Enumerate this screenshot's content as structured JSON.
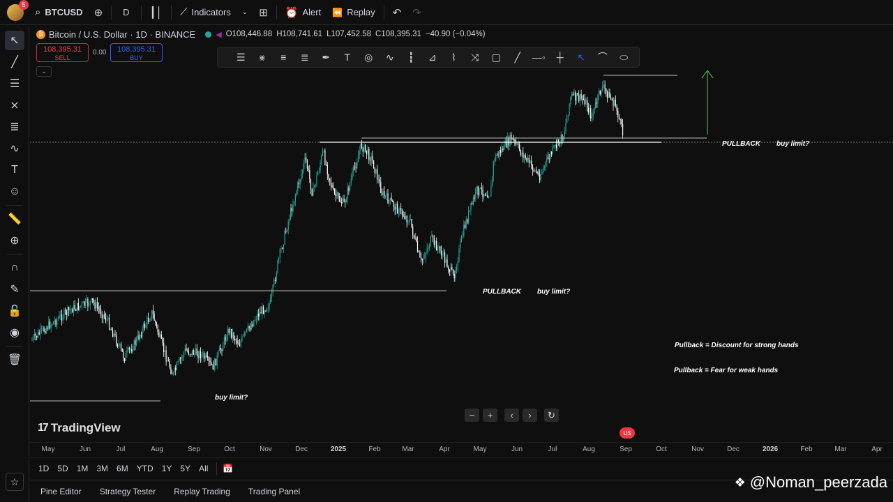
{
  "topbar": {
    "avatar_badge": "5",
    "symbol": "BTCUSD",
    "interval": "D",
    "indicators_label": "Indicators",
    "alert_label": "Alert",
    "replay_label": "Replay"
  },
  "legend": {
    "title": "Bitcoin / U.S. Dollar · 1D · BINANCE",
    "open": "O108,446.88",
    "high": "H108,741.61",
    "low": "L107,452.58",
    "close": "C108,395.31",
    "change": "−40.90 (−0.04%)"
  },
  "trade": {
    "sell_price": "108,395.31",
    "sell_label": "SELL",
    "spread": "0.00",
    "buy_price": "108,395.31",
    "buy_label": "BUY"
  },
  "annotations": {
    "pullback_1": "PULLBACK",
    "buy_limit_1": "buy limit?",
    "pullback_2": "PULLBACK",
    "buy_limit_2": "buy limit?",
    "buy_limit_3": "buy limit?",
    "note_1": "Pullback = Discount for strong hands",
    "note_2": "Pullback = Fear for weak hands"
  },
  "watermark": "TradingView",
  "time_axis": [
    "May",
    "Jun",
    "Jul",
    "Aug",
    "Sep",
    "Oct",
    "Nov",
    "Dec",
    "2025",
    "Feb",
    "Mar",
    "Apr",
    "May",
    "Jun",
    "Jul",
    "Aug",
    "Sep",
    "Oct",
    "Nov",
    "Dec",
    "2026",
    "Feb",
    "Mar",
    "Apr"
  ],
  "ranges": [
    "1D",
    "5D",
    "1M",
    "3M",
    "6M",
    "YTD",
    "1Y",
    "5Y",
    "All"
  ],
  "bottom_tabs": [
    "Pine Editor",
    "Strategy Tester",
    "Replay Trading",
    "Trading Panel"
  ],
  "credit": "@Noman_peerzada",
  "colors": {
    "up": "#26a69a",
    "down": "#ffffff",
    "bg": "#0f0f0f",
    "arrow": "#4caf50"
  },
  "chart_data": {
    "type": "candlestick",
    "symbol": "BTCUSD",
    "timeframe": "1D",
    "approx_close_path": [
      {
        "date": "2024-05",
        "close": 64000
      },
      {
        "date": "2024-06",
        "close": 68000
      },
      {
        "date": "2024-07",
        "close": 57000
      },
      {
        "date": "2024-08",
        "close": 58000
      },
      {
        "date": "2024-09",
        "close": 63000
      },
      {
        "date": "2024-10",
        "close": 70000
      },
      {
        "date": "2024-11",
        "close": 97000
      },
      {
        "date": "2024-12",
        "close": 94000
      },
      {
        "date": "2025-01",
        "close": 102000
      },
      {
        "date": "2025-02",
        "close": 84000
      },
      {
        "date": "2025-03",
        "close": 82000
      },
      {
        "date": "2025-04",
        "close": 94000
      },
      {
        "date": "2025-05",
        "close": 104000
      },
      {
        "date": "2025-06",
        "close": 107000
      },
      {
        "date": "2025-07",
        "close": 115000
      },
      {
        "date": "2025-08",
        "close": 108000
      }
    ],
    "last_close": 108395.31
  }
}
